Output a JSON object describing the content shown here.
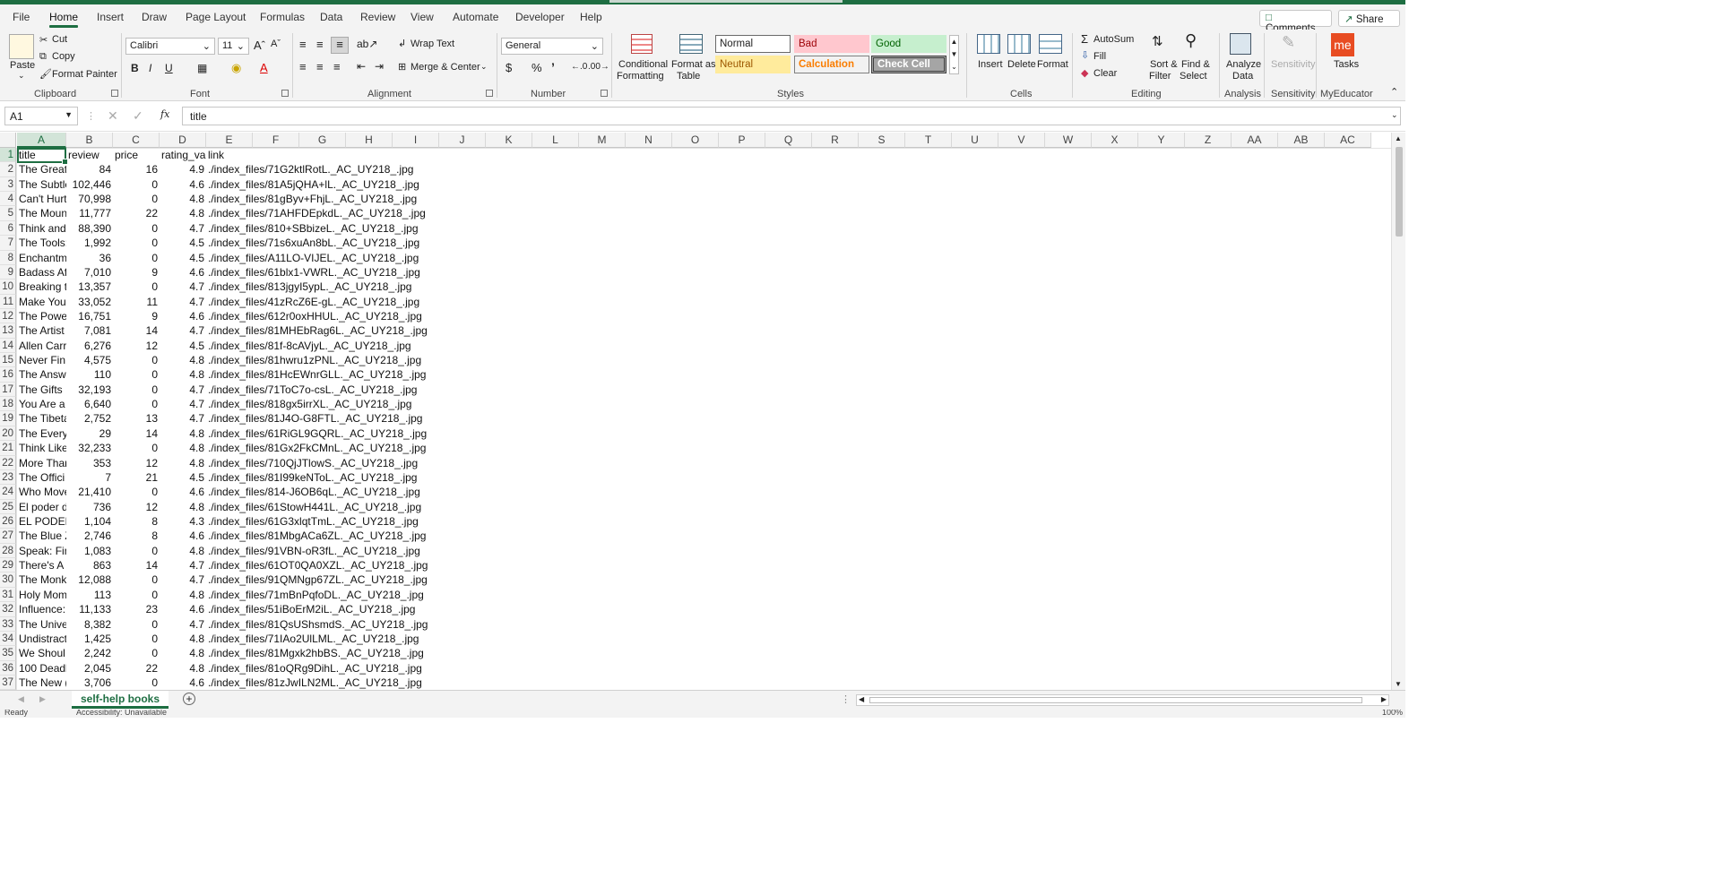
{
  "menu": {
    "tabs": [
      "File",
      "Home",
      "Insert",
      "Draw",
      "Page Layout",
      "Formulas",
      "Data",
      "Review",
      "View",
      "Automate",
      "Developer",
      "Help"
    ],
    "active": "Home",
    "comments_label": "Comments",
    "share_label": "Share"
  },
  "ribbon": {
    "clipboard": {
      "paste": "Paste",
      "cut": "Cut",
      "copy": "Copy",
      "format_painter": "Format Painter",
      "label": "Clipboard"
    },
    "font": {
      "family": "Calibri",
      "size": "11",
      "label": "Font",
      "bold": "B",
      "italic": "I",
      "underline": "U"
    },
    "alignment": {
      "wrap": "Wrap Text",
      "merge": "Merge & Center",
      "label": "Alignment"
    },
    "number": {
      "format": "General",
      "label": "Number",
      "currency": "$",
      "percent": "%",
      "comma": "’"
    },
    "styles": {
      "label": "Styles",
      "conditional": "Conditional",
      "formatting": "Formatting",
      "format_as": "Format as",
      "table": "Table",
      "normal": "Normal",
      "bad": "Bad",
      "good": "Good",
      "neutral": "Neutral",
      "calculation": "Calculation",
      "check_cell": "Check Cell"
    },
    "cells": {
      "label": "Cells",
      "insert": "Insert",
      "delete": "Delete",
      "format": "Format"
    },
    "editing": {
      "label": "Editing",
      "autosum": "AutoSum",
      "fill": "Fill",
      "clear": "Clear",
      "sort": "Sort &",
      "filter": "Filter",
      "find": "Find &",
      "select": "Select"
    },
    "analysis": {
      "label": "Analysis",
      "analyze": "Analyze",
      "data": "Data"
    },
    "sensitivity": {
      "label": "Sensitivity",
      "button": "Sensitivity"
    },
    "myeducator": {
      "label": "MyEducator",
      "tasks": "Tasks",
      "logo": "me"
    }
  },
  "formula_bar": {
    "name_box": "A1",
    "formula": "title",
    "fx": "fx"
  },
  "columns": [
    "A",
    "B",
    "C",
    "D",
    "E",
    "F",
    "G",
    "H",
    "I",
    "J",
    "K",
    "L",
    "M",
    "N",
    "O",
    "P",
    "Q",
    "R",
    "S",
    "T",
    "U",
    "V",
    "W",
    "X",
    "Y",
    "Z",
    "AA",
    "AB",
    "AC"
  ],
  "header_row": [
    "title",
    "review",
    "price",
    "rating_val",
    "link"
  ],
  "rows": [
    [
      "The Great",
      "84",
      "16",
      "4.9",
      "./index_files/71G2ktlRotL._AC_UY218_.jpg"
    ],
    [
      "The Subtle",
      "102,446",
      "0",
      "4.6",
      "./index_files/81A5jQHA+lL._AC_UY218_.jpg"
    ],
    [
      "Can't Hurt",
      "70,998",
      "0",
      "4.8",
      "./index_files/81gByv+FhjL._AC_UY218_.jpg"
    ],
    [
      "The Moun",
      "11,777",
      "22",
      "4.8",
      "./index_files/71AHFDEpkdL._AC_UY218_.jpg"
    ],
    [
      "Think and",
      "88,390",
      "0",
      "4.7",
      "./index_files/810+SBbizeL._AC_UY218_.jpg"
    ],
    [
      "The Tools:",
      "1,992",
      "0",
      "4.5",
      "./index_files/71s6xuAn8bL._AC_UY218_.jpg"
    ],
    [
      "Enchantm",
      "36",
      "0",
      "4.5",
      "./index_files/A11LO-VIJEL._AC_UY218_.jpg"
    ],
    [
      "Badass Af",
      "7,010",
      "9",
      "4.6",
      "./index_files/61blx1-VWRL._AC_UY218_.jpg"
    ],
    [
      "Breaking t",
      "13,357",
      "0",
      "4.7",
      "./index_files/813jgyI5ypL._AC_UY218_.jpg"
    ],
    [
      "Make You",
      "33,052",
      "11",
      "4.7",
      "./index_files/41zRcZ6E-gL._AC_UY218_.jpg"
    ],
    [
      "The Powe",
      "16,751",
      "9",
      "4.6",
      "./index_files/612r0oxHHUL._AC_UY218_.jpg"
    ],
    [
      "The Artist",
      "7,081",
      "14",
      "4.7",
      "./index_files/81MHEbRag6L._AC_UY218_.jpg"
    ],
    [
      "Allen Carr",
      "6,276",
      "12",
      "4.5",
      "./index_files/81f-8cAVjyL._AC_UY218_.jpg"
    ],
    [
      "Never Fin",
      "4,575",
      "0",
      "4.8",
      "./index_files/81hwru1zPNL._AC_UY218_.jpg"
    ],
    [
      "The Answ",
      "110",
      "0",
      "4.8",
      "./index_files/81HcEWnrGLL._AC_UY218_.jpg"
    ],
    [
      "The Gifts",
      "32,193",
      "0",
      "4.7",
      "./index_files/71ToC7o-csL._AC_UY218_.jpg"
    ],
    [
      "You Are a",
      "6,640",
      "0",
      "4.7",
      "./index_files/818gx5irrXL._AC_UY218_.jpg"
    ],
    [
      "The Tibeta",
      "2,752",
      "13",
      "4.7",
      "./index_files/81J4O-G8FTL._AC_UY218_.jpg"
    ],
    [
      "The Every",
      "29",
      "14",
      "4.8",
      "./index_files/61RiGL9GQRL._AC_UY218_.jpg"
    ],
    [
      "Think Like",
      "32,233",
      "0",
      "4.8",
      "./index_files/81Gx2FkCMnL._AC_UY218_.jpg"
    ],
    [
      "More Thar",
      "353",
      "12",
      "4.8",
      "./index_files/710QjJTlowS._AC_UY218_.jpg"
    ],
    [
      "The Offici",
      "7",
      "21",
      "4.5",
      "./index_files/81I99keNToL._AC_UY218_.jpg"
    ],
    [
      "Who Move",
      "21,410",
      "0",
      "4.6",
      "./index_files/814-J6OB6qL._AC_UY218_.jpg"
    ],
    [
      "El poder d",
      "736",
      "12",
      "4.8",
      "./index_files/61StowH441L._AC_UY218_.jpg"
    ],
    [
      "EL PODER",
      "1,104",
      "8",
      "4.3",
      "./index_files/61G3xlqtTmL._AC_UY218_.jpg"
    ],
    [
      "The Blue Z",
      "2,746",
      "8",
      "4.6",
      "./index_files/81MbgACa6ZL._AC_UY218_.jpg"
    ],
    [
      "Speak: Fin",
      "1,083",
      "0",
      "4.8",
      "./index_files/91VBN-oR3fL._AC_UY218_.jpg"
    ],
    [
      "There's A",
      "863",
      "14",
      "4.7",
      "./index_files/61OT0QA0XZL._AC_UY218_.jpg"
    ],
    [
      "The Monk",
      "12,088",
      "0",
      "4.7",
      "./index_files/91QMNgp67ZL._AC_UY218_.jpg"
    ],
    [
      "Holy Mom",
      "113",
      "0",
      "4.8",
      "./index_files/71mBnPqfoDL._AC_UY218_.jpg"
    ],
    [
      "Influence:",
      "11,133",
      "23",
      "4.6",
      "./index_files/51iBoErM2iL._AC_UY218_.jpg"
    ],
    [
      "The Unive",
      "8,382",
      "0",
      "4.7",
      "./index_files/81QsUShsmdS._AC_UY218_.jpg"
    ],
    [
      "Undistract",
      "1,425",
      "0",
      "4.8",
      "./index_files/71IAo2UlLML._AC_UY218_.jpg"
    ],
    [
      "We Shoul",
      "2,242",
      "0",
      "4.8",
      "./index_files/81Mgxk2hbBS._AC_UY218_.jpg"
    ],
    [
      "100 Deadl",
      "2,045",
      "22",
      "4.8",
      "./index_files/81oQRg9DihL._AC_UY218_.jpg"
    ],
    [
      "The New (",
      "3,706",
      "0",
      "4.6",
      "./index_files/81zJwILN2ML._AC_UY218_.jpg"
    ]
  ],
  "sheet_tab": "self-help books",
  "status": {
    "ready": "Ready",
    "accessibility": "Accessibility: Unavailable",
    "zoom": "100%"
  },
  "colors": {
    "accent": "#1e6e42",
    "bad_bg": "#ffc7ce",
    "bad_fg": "#9c0006",
    "good_bg": "#c6efce",
    "good_fg": "#006100",
    "neutral_bg": "#ffeb9c",
    "neutral_fg": "#9c5700",
    "calc_fg": "#fa7d00",
    "check_bg": "#a5a5a5"
  }
}
